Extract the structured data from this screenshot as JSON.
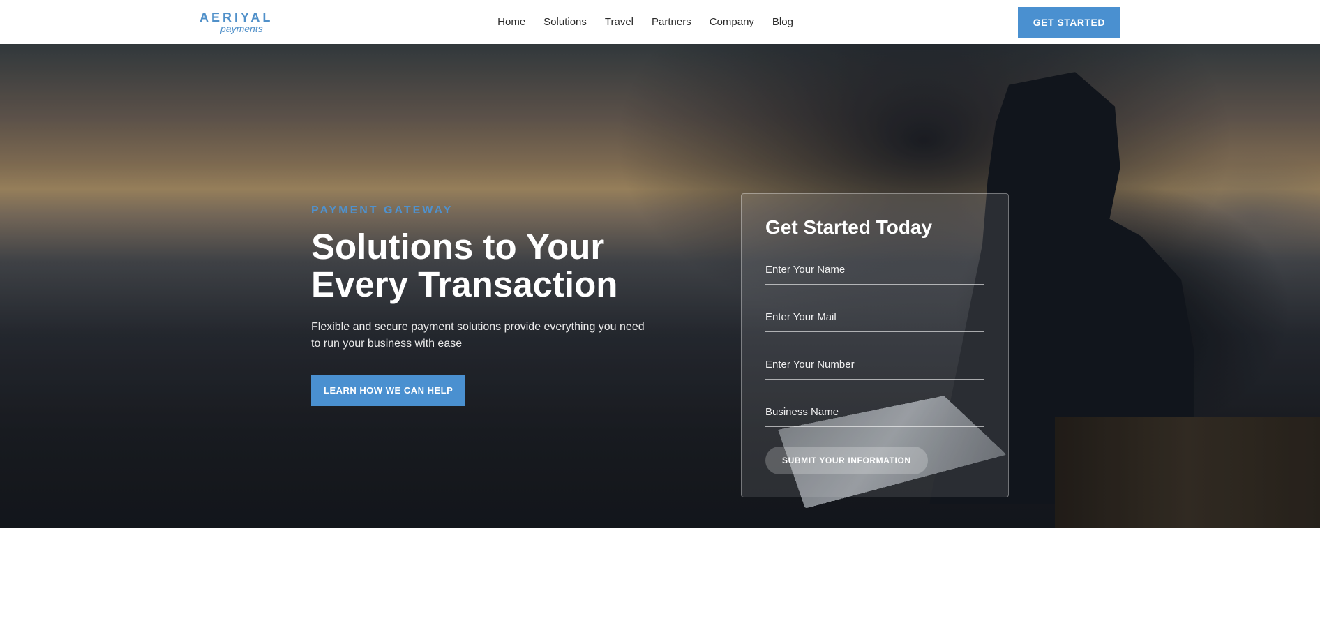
{
  "logo": {
    "main": "AERIYAL",
    "sub": "payments"
  },
  "nav": {
    "items": [
      {
        "label": "Home"
      },
      {
        "label": "Solutions"
      },
      {
        "label": "Travel"
      },
      {
        "label": "Partners"
      },
      {
        "label": "Company"
      },
      {
        "label": "Blog"
      }
    ],
    "cta": "GET STARTED"
  },
  "hero": {
    "eyebrow": "PAYMENT GATEWAY",
    "title": "Solutions to Your Every Transaction",
    "desc": "Flexible and secure payment solutions provide everything you need to run your business with ease",
    "learn_btn": "LEARN HOW WE CAN HELP"
  },
  "form": {
    "title": "Get Started Today",
    "name_ph": "Enter Your Name",
    "mail_ph": "Enter Your Mail",
    "number_ph": "Enter Your Number",
    "business_ph": "Business Name",
    "submit": "SUBMIT YOUR INFORMATION"
  }
}
